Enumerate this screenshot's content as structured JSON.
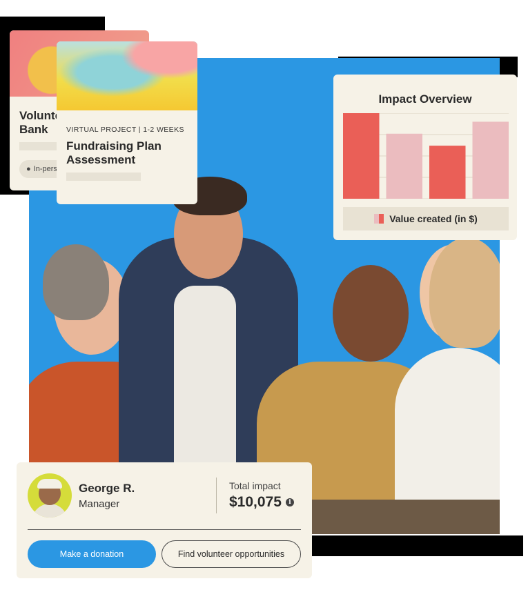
{
  "cards": {
    "volunteer": {
      "title": "Volunteer at the Food Bank",
      "location": "In-person"
    },
    "fundraising": {
      "meta": "VIRTUAL PROJECT | 1-2 WEEKS",
      "title": "Fundraising Plan Assessment"
    }
  },
  "impact": {
    "title": "Impact Overview",
    "legend": "Value created (in $)"
  },
  "chart_data": {
    "type": "bar",
    "title": "Impact Overview",
    "categories": [
      "",
      "",
      "",
      ""
    ],
    "values": [
      100,
      76,
      62,
      90
    ],
    "colors": [
      "#ea5f57",
      "#ebbcbf",
      "#ea5f57",
      "#ebbcbf"
    ],
    "ylim": [
      0,
      100
    ],
    "grid": true,
    "legend": "bottom",
    "series": [
      {
        "name": "Value created (in $)",
        "values": [
          100,
          76,
          62,
          90
        ]
      }
    ]
  },
  "profile": {
    "name": "George R.",
    "role": "Manager",
    "impact_label": "Total impact",
    "impact_value": "$10,075",
    "donate_label": "Make a donation",
    "find_label": "Find volunteer opportunities"
  },
  "colors": {
    "brand_blue": "#2b97e3",
    "card_bg": "#f6f2e7",
    "bar_red": "#ea5f57",
    "bar_pink": "#ebbcbf"
  }
}
